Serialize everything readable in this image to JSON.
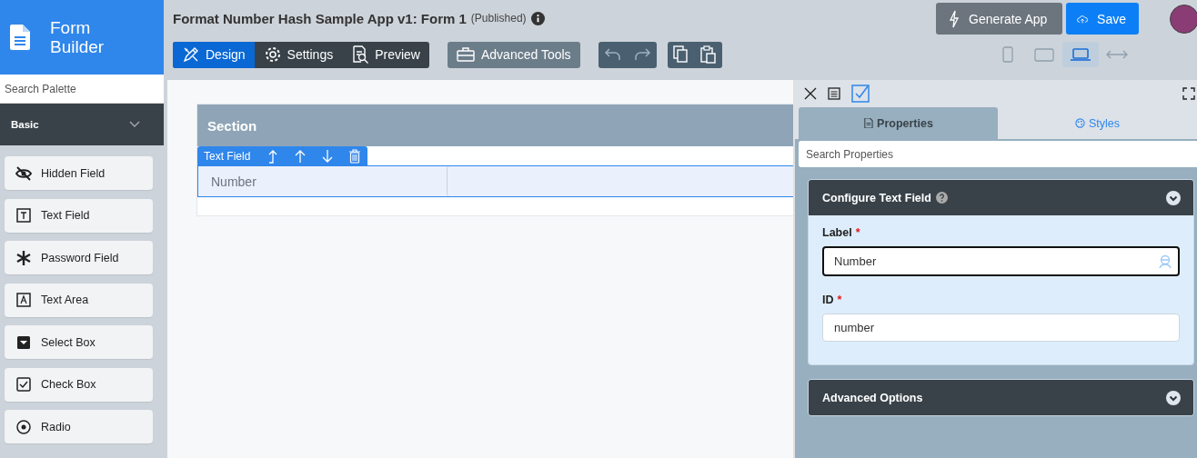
{
  "brand": {
    "lines": [
      "Form",
      "Builder"
    ]
  },
  "header": {
    "title": "Format Number Hash Sample App v1: Form 1",
    "status": "(Published)"
  },
  "mode_tabs": [
    {
      "label": "Design",
      "kind": "design",
      "selected": true
    },
    {
      "label": "Settings",
      "kind": "settings",
      "selected": false
    },
    {
      "label": "Preview",
      "kind": "preview",
      "selected": false
    }
  ],
  "advanced_tools": {
    "label": "Advanced Tools"
  },
  "actions": {
    "generate": "Generate App",
    "save": "Save"
  },
  "devices": [
    {
      "kind": "phone",
      "selected": false
    },
    {
      "kind": "tablet",
      "selected": false
    },
    {
      "kind": "laptop",
      "selected": true
    },
    {
      "kind": "fluid",
      "selected": false
    }
  ],
  "palette": {
    "search": {
      "placeholder": "Search Palette"
    },
    "group": {
      "label": "Basic",
      "expanded": true
    },
    "items": [
      {
        "kind": "hidden",
        "label": "Hidden Field"
      },
      {
        "kind": "text",
        "label": "Text Field"
      },
      {
        "kind": "password",
        "label": "Password Field"
      },
      {
        "kind": "textarea",
        "label": "Text Area"
      },
      {
        "kind": "select",
        "label": "Select Box"
      },
      {
        "kind": "checkbox",
        "label": "Check Box"
      },
      {
        "kind": "radio",
        "label": "Radio"
      }
    ]
  },
  "canvas": {
    "section": "Section",
    "toolbar_label": "Text Field",
    "field_label": "Number"
  },
  "panel": {
    "tabs": [
      {
        "label": "Properties",
        "kind": "properties",
        "selected": true
      },
      {
        "label": "Styles",
        "kind": "styles",
        "selected": false
      }
    ],
    "search": {
      "placeholder": "Search Properties"
    },
    "configure": {
      "title": "Configure Text Field",
      "expanded": true,
      "fields": [
        {
          "label": "Label",
          "required_mark": "*",
          "value": "Number",
          "focused": true
        },
        {
          "label": "ID",
          "required_mark": "*",
          "value": "number",
          "focused": false
        }
      ]
    },
    "advanced": {
      "title": "Advanced Options",
      "expanded": false
    }
  }
}
